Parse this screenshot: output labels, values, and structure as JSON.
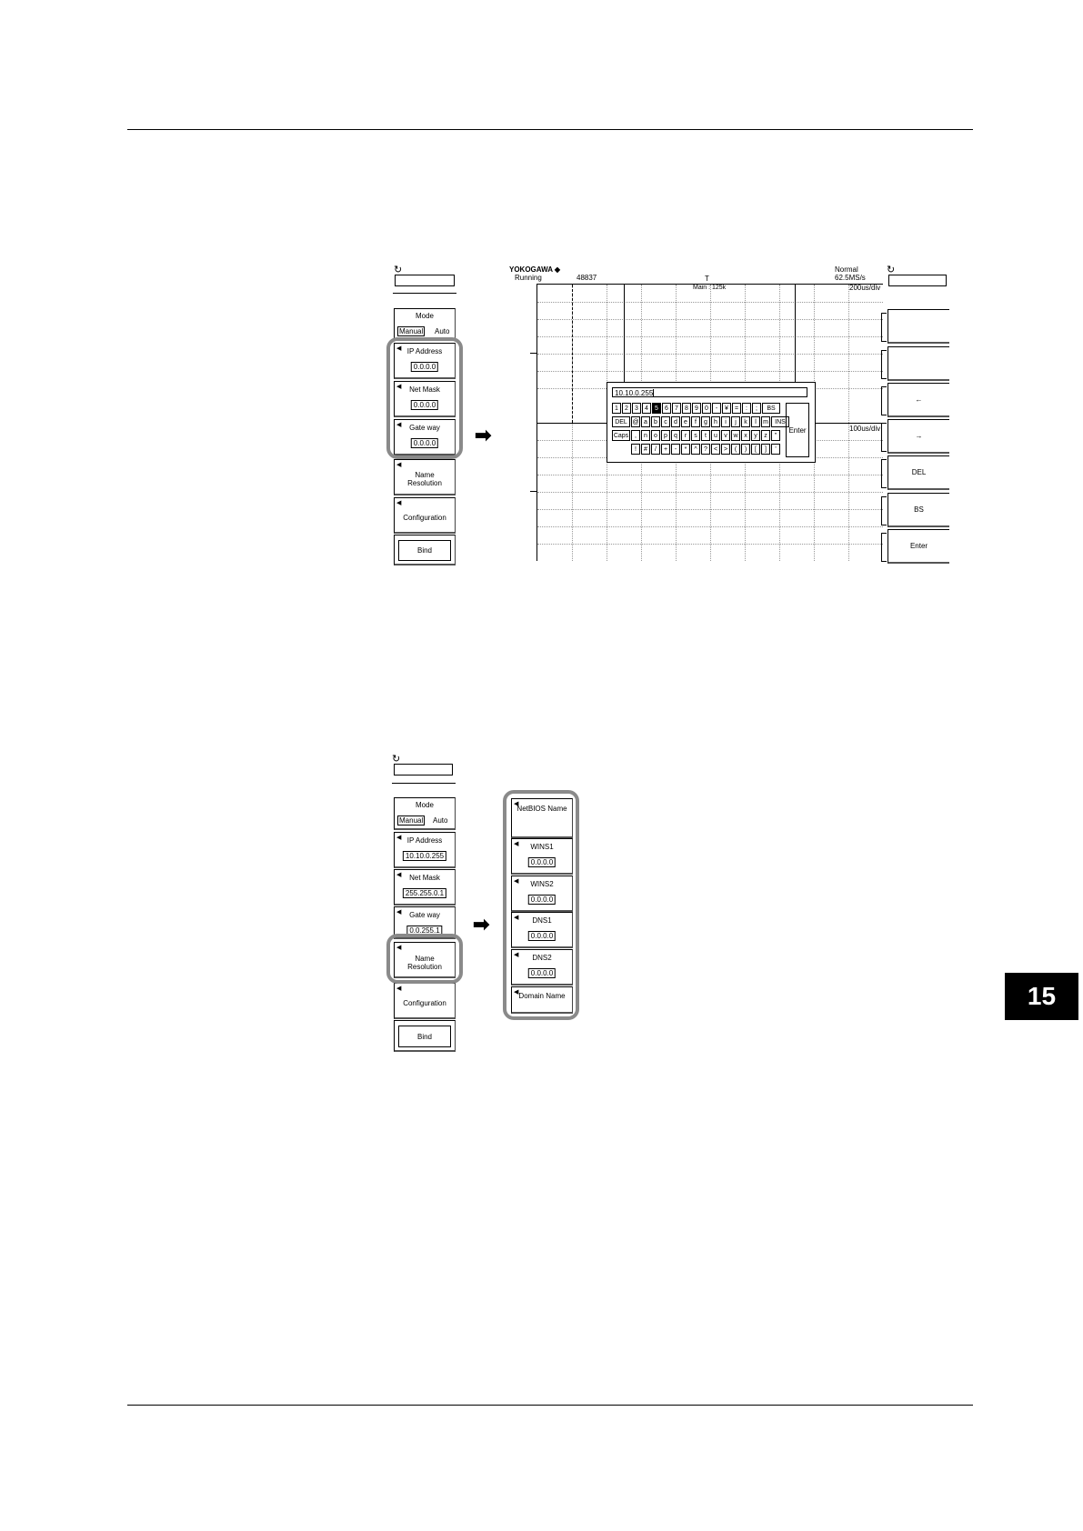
{
  "tab_number": "15",
  "menu1": {
    "mode_label": "Mode",
    "mode_manual": "Manual",
    "mode_auto": "Auto",
    "ip_label": "IP Address",
    "ip_value": "0.0.0.0",
    "mask_label": "Net Mask",
    "mask_value": "0.0.0.0",
    "gate_label": "Gate way",
    "gate_value": "0.0.0.0",
    "name_res_1": "Name",
    "name_res_2": "Resolution",
    "config_label": "Configuration",
    "bind_label": "Bind"
  },
  "screen": {
    "brand": "YOKOGAWA ◆",
    "status": "Running",
    "count": "48837",
    "trigger_mark": "T",
    "main_info": "Main : 125k",
    "acq_mode": "Normal",
    "sample_rate": "62.5MS/s",
    "timebase": "200us/div",
    "zoom_timebase": "100us/div"
  },
  "keyboard": {
    "input_value": "10.10.0.255",
    "row1": [
      "1",
      "2",
      "3",
      "4",
      "5",
      "6",
      "7",
      "8",
      "9",
      "0",
      "-",
      "¥",
      "=",
      ":",
      ";"
    ],
    "row1_end": "BS",
    "row2_start": "DEL",
    "row2": [
      "@",
      "a",
      "b",
      "c",
      "d",
      "e",
      "f",
      "g",
      "h",
      "i",
      "j",
      "k",
      "l",
      "m"
    ],
    "row2_end": "INS",
    "row3_start": "Caps",
    "row3": [
      ",",
      "n",
      "o",
      "p",
      "q",
      "r",
      "s",
      "t",
      "u",
      "v",
      "w",
      "x",
      "y",
      "z",
      "\""
    ],
    "row4": [
      "!",
      "#",
      "/",
      "+",
      "-",
      "*",
      "^",
      "?",
      "<",
      ">",
      "(",
      ")",
      "[",
      "]",
      "'"
    ],
    "enter": "Enter",
    "selected_key": "5"
  },
  "right_keys": [
    "",
    "",
    "←",
    "→",
    "DEL",
    "BS",
    "Enter"
  ],
  "menu2": {
    "mode_label": "Mode",
    "mode_manual": "Manual",
    "mode_auto": "Auto",
    "ip_label": "IP Address",
    "ip_value": "10.10.0.255",
    "mask_label": "Net Mask",
    "mask_value": "255.255.0.1",
    "gate_label": "Gate way",
    "gate_value": "0.0.255.1",
    "name_res_1": "Name",
    "name_res_2": "Resolution",
    "config_label": "Configuration",
    "bind_label": "Bind"
  },
  "submenu": {
    "netbios_label": "NetBIOS Name",
    "wins1_label": "WINS1",
    "wins1_value": "0.0.0.0",
    "wins2_label": "WINS2",
    "wins2_value": "0.0.0.0",
    "dns1_label": "DNS1",
    "dns1_value": "0.0.0.0",
    "dns2_label": "DNS2",
    "dns2_value": "0.0.0.0",
    "domain_label": "Domain Name"
  },
  "arrow": "➡"
}
